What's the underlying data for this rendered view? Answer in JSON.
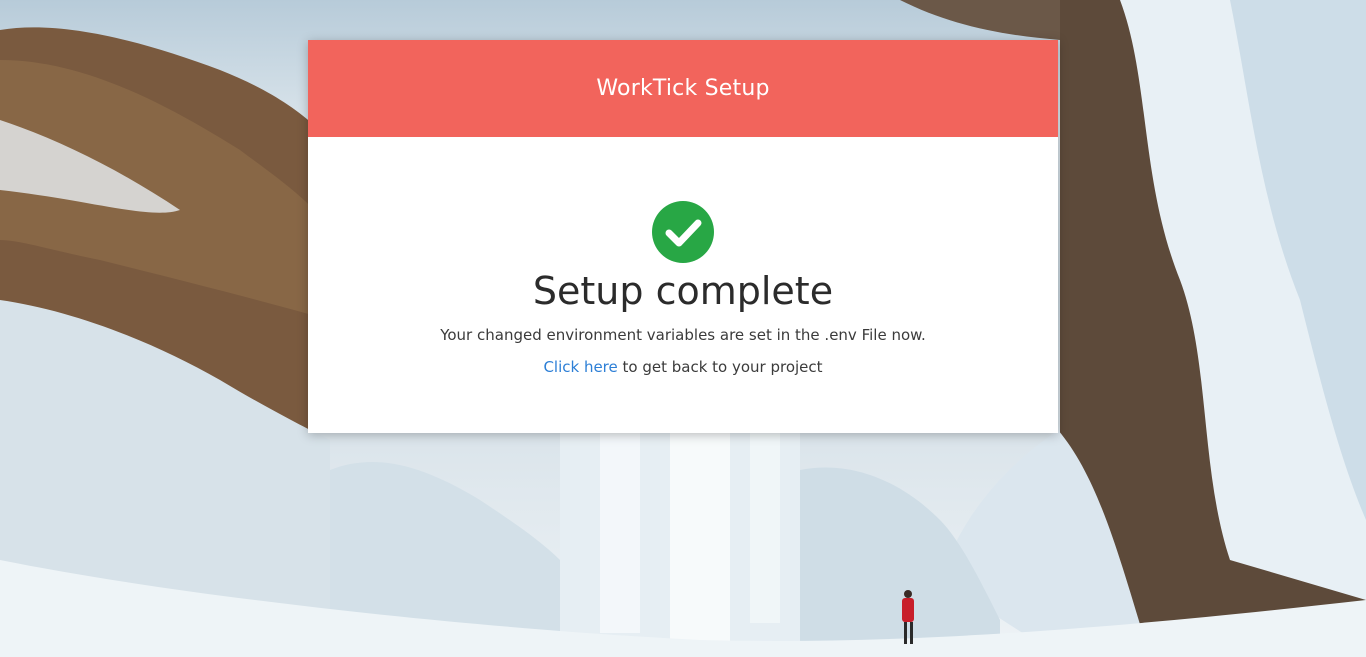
{
  "header": {
    "title": "WorkTick Setup"
  },
  "status": {
    "icon": "check-circle-icon",
    "icon_color": "#28a745",
    "heading": "Setup complete",
    "message": "Your changed environment variables are set in the .env File now."
  },
  "back_link": {
    "link_text": "Click here",
    "suffix_text": " to get back to your project"
  },
  "colors": {
    "header_bg": "#f2645c",
    "link": "#2d7fd6"
  }
}
